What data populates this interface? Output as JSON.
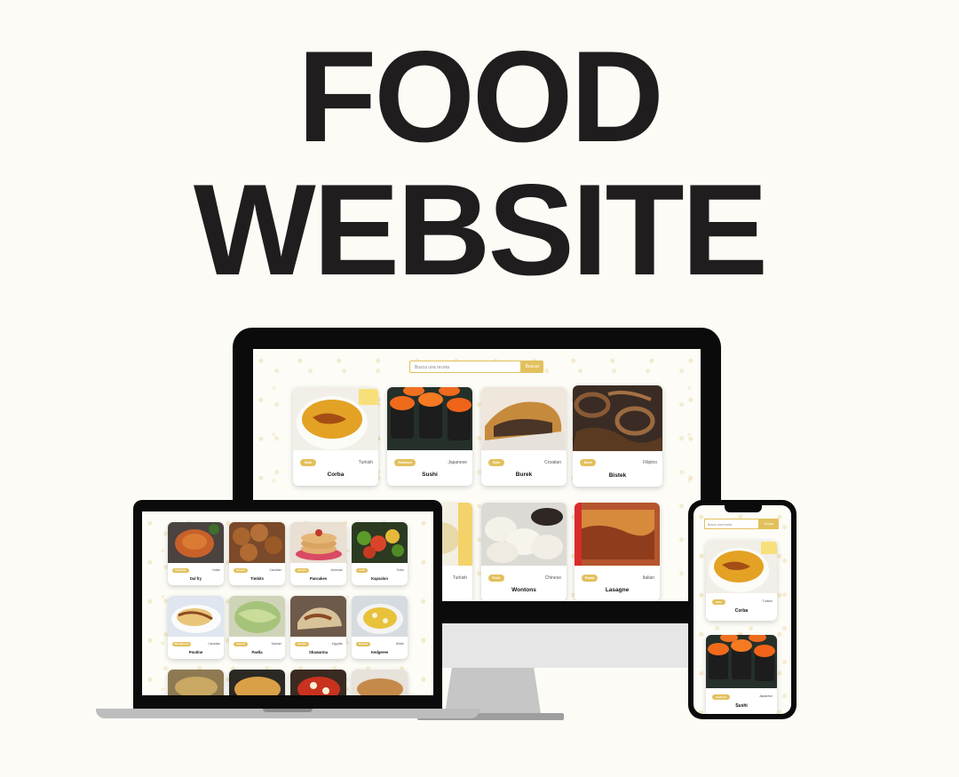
{
  "headline": {
    "line1": "FOOD",
    "line2": "WEBSITE"
  },
  "colors": {
    "accent": "#e2c05c",
    "background": "#fcfbf6",
    "text": "#1f1d1d"
  },
  "search": {
    "placeholder": "Busca una receta",
    "button_label": "Buscar"
  },
  "monitor": {
    "cards": [
      {
        "title": "Corba",
        "tag": "Side",
        "origin": "Turkish"
      },
      {
        "title": "Sushi",
        "tag": "Seafood",
        "origin": "Japanese"
      },
      {
        "title": "Burek",
        "tag": "Side",
        "origin": "Croatian"
      },
      {
        "title": "Bistek",
        "tag": "Beef",
        "origin": "Filipino"
      },
      {
        "title": "",
        "tag": "",
        "origin": "Turkish"
      },
      {
        "title": "Wontons",
        "tag": "Pork",
        "origin": "Chinese"
      },
      {
        "title": "Lasagne",
        "tag": "Pasta",
        "origin": "Italian"
      }
    ]
  },
  "laptop": {
    "cards": [
      {
        "title": "Dal fry",
        "tag": "Vegetarian",
        "origin": "Indian"
      },
      {
        "title": "Timbits",
        "tag": "Dessert",
        "origin": "Canadian"
      },
      {
        "title": "Pancakes",
        "tag": "Dessert",
        "origin": "American"
      },
      {
        "title": "Kapsalon",
        "tag": "Lamb",
        "origin": "Dutch"
      },
      {
        "title": "Poutine",
        "tag": "Miscellaneous",
        "origin": "Canadian"
      },
      {
        "title": "Paella",
        "tag": "Seafood",
        "origin": "Spanish"
      },
      {
        "title": "Shawarma",
        "tag": "Chicken",
        "origin": "Egyptian"
      },
      {
        "title": "Kedgeree",
        "tag": "Seafood",
        "origin": "British"
      }
    ]
  },
  "phone": {
    "cards": [
      {
        "title": "Corba",
        "tag": "Side",
        "origin": "Turkish"
      },
      {
        "title": "Sushi",
        "tag": "Seafood",
        "origin": "Japanese"
      }
    ]
  },
  "icons": [
    "food-pattern-icon",
    "desktop-monitor-icon",
    "laptop-icon",
    "smartphone-icon"
  ]
}
